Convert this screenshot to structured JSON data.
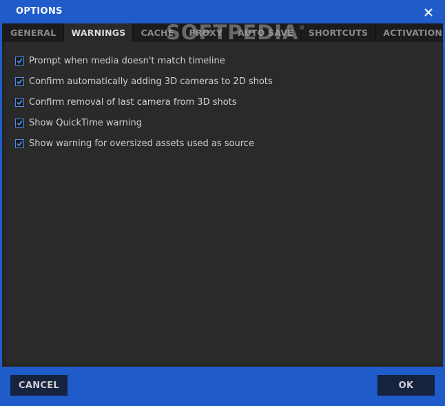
{
  "window": {
    "title": "OPTIONS"
  },
  "tabs": [
    {
      "label": "GENERAL",
      "active": false
    },
    {
      "label": "WARNINGS",
      "active": true
    },
    {
      "label": "CACHE",
      "active": false
    },
    {
      "label": "PROXY",
      "active": false
    },
    {
      "label": "AUTO SAVE",
      "active": false
    },
    {
      "label": "SHORTCUTS",
      "active": false
    },
    {
      "label": "ACTIVATION",
      "active": false
    }
  ],
  "watermark": {
    "text": "SOFTPEDIA",
    "mark": "®"
  },
  "warnings": [
    {
      "label": "Prompt when media doesn't match timeline",
      "checked": true
    },
    {
      "label": "Confirm automatically adding 3D cameras to 2D shots",
      "checked": true
    },
    {
      "label": "Confirm removal of last camera from 3D shots",
      "checked": true
    },
    {
      "label": "Show QuickTime warning",
      "checked": true
    },
    {
      "label": "Show warning for oversized assets used as source",
      "checked": true
    }
  ],
  "footer": {
    "cancel_label": "CANCEL",
    "ok_label": "OK"
  },
  "colors": {
    "accent": "#1f5bc9",
    "panel": "#2a2a2a",
    "checkbox_border": "#4a8ee8"
  }
}
